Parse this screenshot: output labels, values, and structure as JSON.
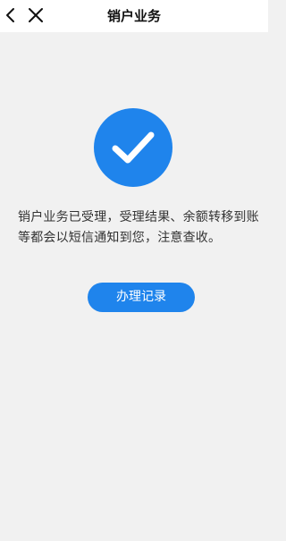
{
  "header": {
    "title": "销户业务",
    "back_icon": "chevron-left-icon",
    "close_icon": "close-icon"
  },
  "result": {
    "icon": "check-circle-icon",
    "icon_color": "#1f84ec",
    "message_line1": "销户业务已受理，受理结果、余额转移到账",
    "message_line2": "等都会以短信通知到您，注意查收。"
  },
  "actions": {
    "record_label": "办理记录",
    "record_color": "#1f84ec"
  }
}
